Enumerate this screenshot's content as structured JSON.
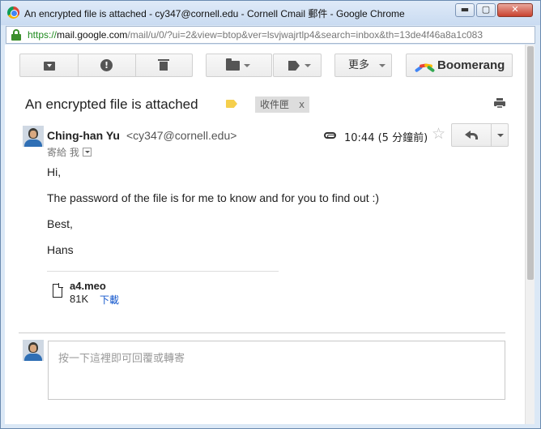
{
  "window": {
    "title": "An encrypted file is attached - cy347@cornell.edu - Cornell Cmail 郵件 - Google Chrome",
    "controls": {
      "minimize": "▬",
      "maximize": "▢",
      "close": "✕"
    }
  },
  "address_bar": {
    "scheme": "https://",
    "host": "mail.google.com",
    "path": "/mail/u/0/?ui=2&view=btop&ver=lsvjwajrtlp4&search=inbox&th=13de4f46a8a1c083"
  },
  "toolbar": {
    "spam_glyph": "!",
    "more_label": "更多",
    "boomerang_label": "Boomerang",
    "icons": [
      "archive-icon",
      "spam-icon",
      "trash-icon",
      "folder-icon",
      "label-icon",
      "boomerang-logo"
    ]
  },
  "thread": {
    "subject": "An encrypted file is attached",
    "label_color": "#f5cf4c",
    "inbox_chip": "收件匣",
    "inbox_chip_remove": "x"
  },
  "message": {
    "sender_name": "Ching-han Yu",
    "sender_email": "<cy347@cornell.edu>",
    "to_line": "寄給 我",
    "time": "10:44 (5 分鐘前)",
    "star": "☆",
    "body": [
      "Hi,",
      "The password of the file is for me to know and for you to find out :)",
      "Best,",
      "Hans"
    ],
    "attachment": {
      "name": "a4.meo",
      "size": "81K",
      "download_label": "下載"
    }
  },
  "reply": {
    "placeholder": "按一下這裡即可回覆或轉寄"
  },
  "colors": {
    "link": "#1155cc",
    "https_green": "#1e8a1e",
    "boomerang": [
      "#4285f4",
      "#ea4335",
      "#fbbc05",
      "#34a853"
    ]
  }
}
